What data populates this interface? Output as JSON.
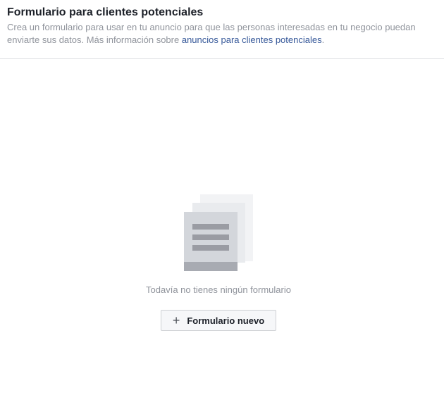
{
  "header": {
    "title": "Formulario para clientes potenciales",
    "description_text": "Crea un formulario para usar en tu anuncio para que las personas interesadas en tu negocio puedan enviarte sus datos. Más información sobre ",
    "description_link": "anuncios para clientes potenciales",
    "description_end": "."
  },
  "empty_state": {
    "icon": "document-stack-icon",
    "message": "Todavía no tienes ningún formulario"
  },
  "new_form_button": {
    "icon": "plus-icon",
    "label": "Formulario nuevo"
  },
  "colors": {
    "title": "#1d2129",
    "muted_text": "#90949c",
    "link": "#365899",
    "button_bg": "#f6f7f9",
    "button_border": "#ced0d4"
  }
}
